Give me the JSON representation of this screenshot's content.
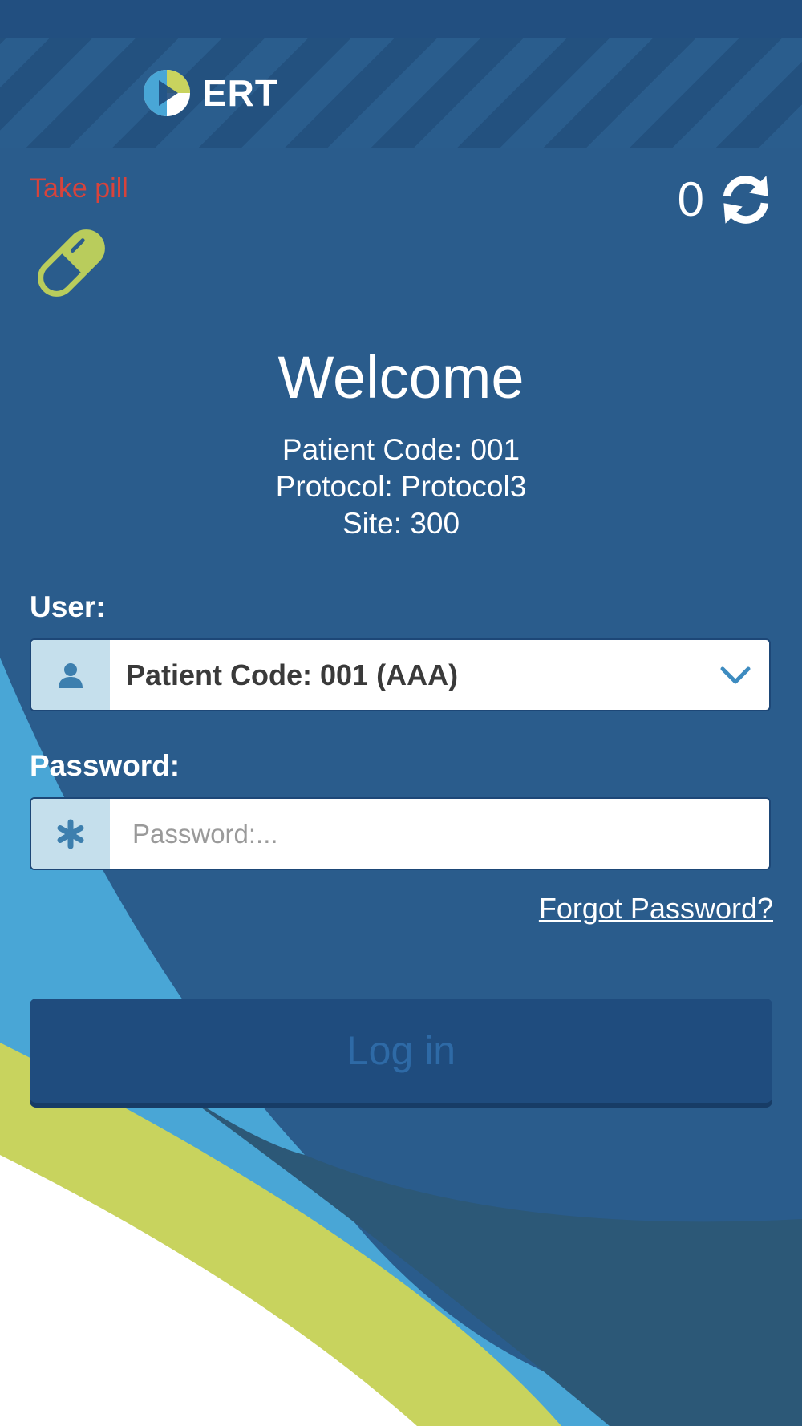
{
  "header": {
    "brand_name": "ERT",
    "logo_icon": "ert-logo-icon"
  },
  "reminder": {
    "label": "Take pill",
    "icon": "pill-icon",
    "color": "#d8433b"
  },
  "sync": {
    "count": "0",
    "icon": "refresh-icon"
  },
  "welcome": {
    "title": "Welcome",
    "patient_code": "Patient Code: 001",
    "protocol": "Protocol: Protocol3",
    "site": "Site: 300"
  },
  "form": {
    "user_label": "User:",
    "user_value": "Patient Code: 001 (AAA)",
    "user_icon": "user-icon",
    "password_label": "Password:",
    "password_placeholder": "Password:...",
    "password_icon": "asterisk-icon",
    "forgot_password": "Forgot Password?",
    "login_label": "Log in"
  },
  "colors": {
    "background": "#2a5c8c",
    "accent_green": "#c8d35e",
    "accent_light_blue": "#4aa8d8",
    "button": "#1f4c7e"
  }
}
